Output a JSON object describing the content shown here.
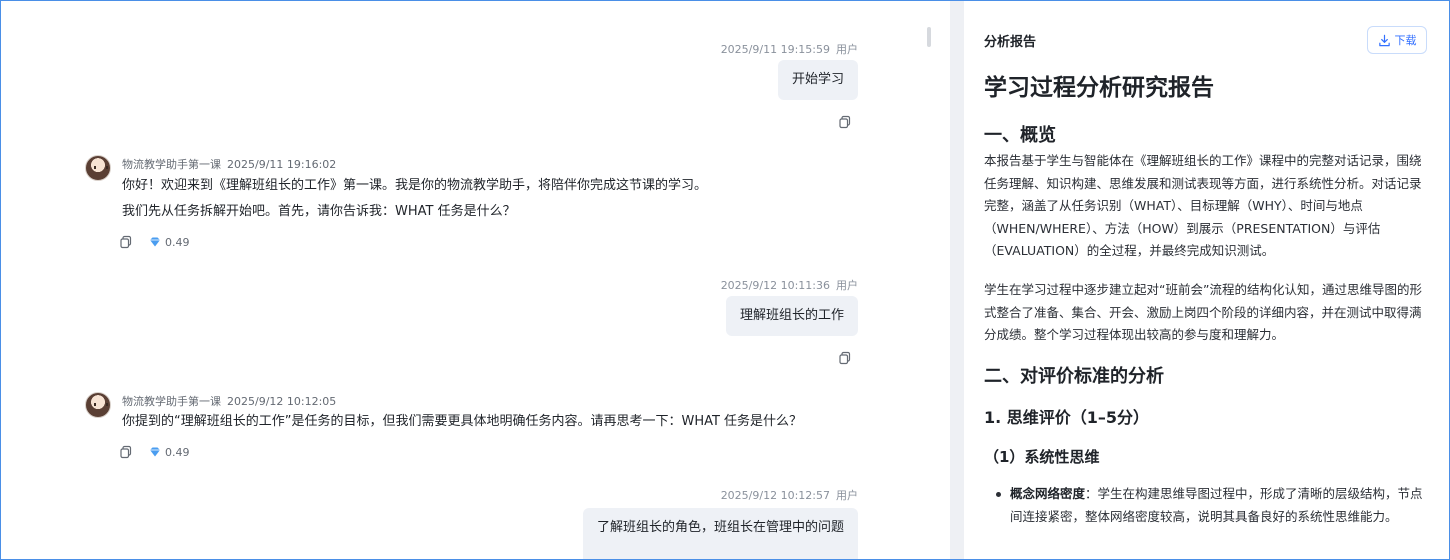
{
  "chat": {
    "messages": [
      {
        "role": "用户",
        "time": "2025/9/11 19:15:59",
        "text": "开始学习"
      },
      {
        "sender": "物流教学助手第一课",
        "time": "2025/9/11 19:16:02",
        "lines": [
          "你好！欢迎来到《理解班组长的工作》第一课。我是你的物流教学助手，将陪伴你完成这节课的学习。",
          "我们先从任务拆解开始吧。首先，请你告诉我：WHAT 任务是什么？"
        ],
        "score": "0.49"
      },
      {
        "role": "用户",
        "time": "2025/9/12 10:11:36",
        "text": "理解班组长的工作"
      },
      {
        "sender": "物流教学助手第一课",
        "time": "2025/9/12 10:12:05",
        "lines": [
          "你提到的“理解班组长的工作”是任务的目标，但我们需要更具体地明确任务内容。请再思考一下：WHAT 任务是什么？"
        ],
        "score": "0.49"
      },
      {
        "role": "用户",
        "time": "2025/9/12 10:12:57",
        "text": "了解班组长的角色，班组长在管理中的问题"
      }
    ]
  },
  "report": {
    "panel_title": "分析报告",
    "download_label": "下载",
    "title": "学习过程分析研究报告",
    "section1": "一、概览",
    "para1": "本报告基于学生与智能体在《理解班组长的工作》课程中的完整对话记录，围绕任务理解、知识构建、思维发展和测试表现等方面，进行系统性分析。对话记录完整，涵盖了从任务识别（WHAT）、目标理解（WHY）、时间与地点（WHEN/WHERE）、方法（HOW）到展示（PRESENTATION）与评估（EVALUATION）的全过程，并最终完成知识测试。",
    "para2": "学生在学习过程中逐步建立起对“班前会”流程的结构化认知，通过思维导图的形式整合了准备、集合、开会、激励上岗四个阶段的详细内容，并在测试中取得满分成绩。整个学习过程体现出较高的参与度和理解力。",
    "section2": "二、对评价标准的分析",
    "sub1": "1. 思维评价（1–5分）",
    "subsub1": "（1）系统性思维",
    "bullet1_label": "概念网络密度",
    "bullet1_text": "：学生在构建思维导图过程中，形成了清晰的层级结构，节点间连接紧密，整体网络密度较高，说明其具备良好的系统性思维能力。"
  }
}
